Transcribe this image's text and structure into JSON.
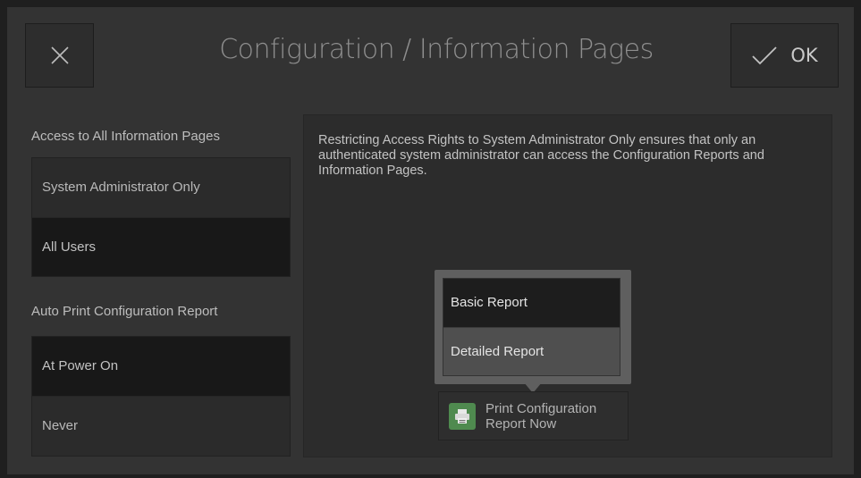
{
  "header": {
    "title": "Configuration / Information Pages",
    "close_icon": "close-icon",
    "ok_label": "OK",
    "ok_icon": "checkmark-icon"
  },
  "access": {
    "label": "Access to All Information Pages",
    "options": [
      "System Administrator Only",
      "All Users"
    ],
    "selected": "All Users"
  },
  "auto_print": {
    "label": "Auto Print Configuration Report",
    "options": [
      "At Power On",
      "Never"
    ],
    "selected": "At Power On"
  },
  "info": {
    "text": "Restricting Access Rights to System Administrator Only ensures that only an authenticated system administrator can access the Configuration Reports and Information Pages."
  },
  "report_menu": {
    "items": [
      "Basic Report",
      "Detailed Report"
    ]
  },
  "print_button": {
    "label": "Print Configuration Report Now",
    "icon": "printer-icon"
  },
  "colors": {
    "background": "#333333",
    "selected_option": "#181818",
    "printer_icon_bg": "#4f8a4f"
  }
}
